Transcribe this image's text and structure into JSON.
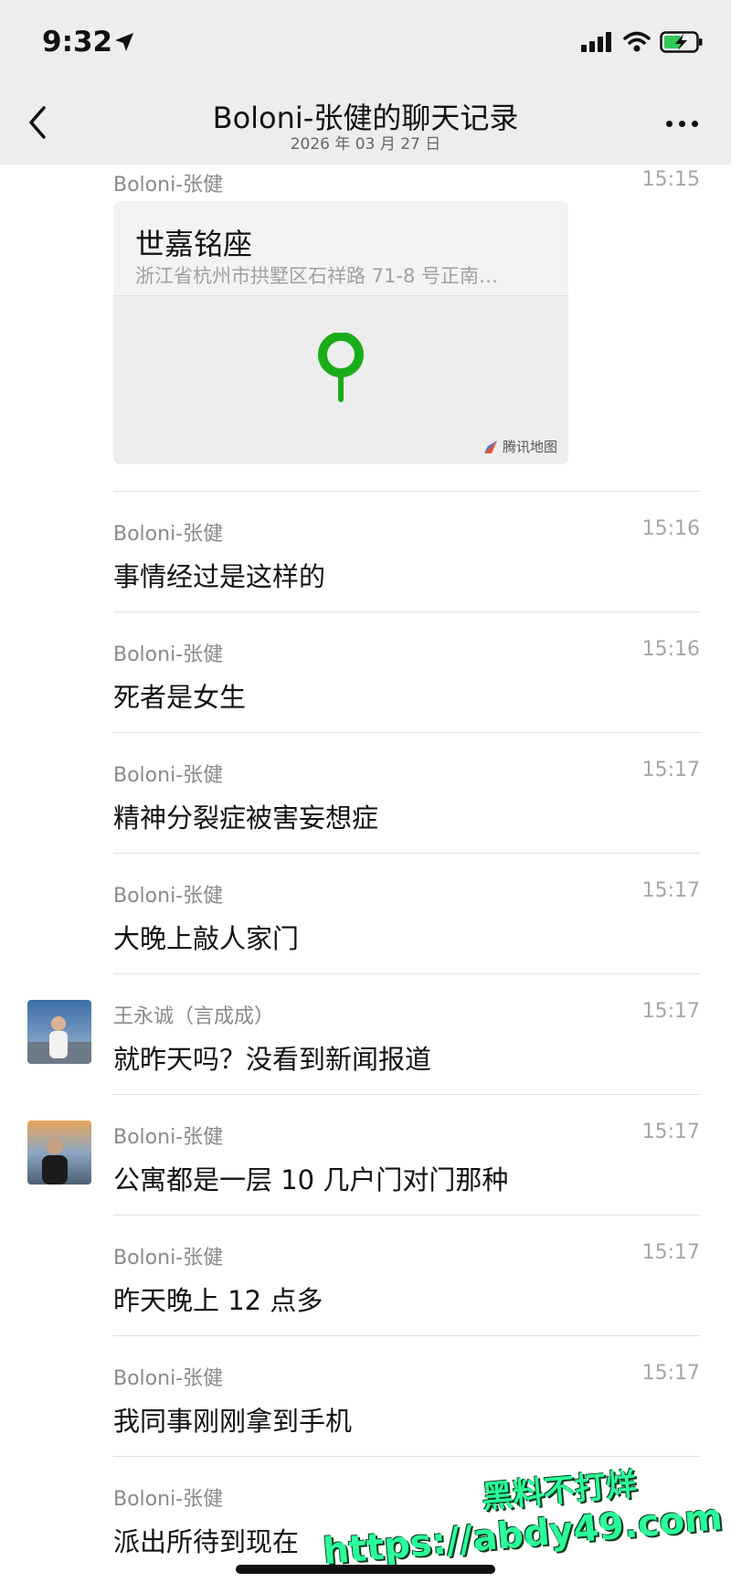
{
  "status_bar": {
    "time": "9:32"
  },
  "nav": {
    "title": "Boloni-张健的聊天记录",
    "subtitle": "2026 年 03 月 27 日"
  },
  "location": {
    "sender": "Boloni-张健",
    "time": "15:15",
    "name": "世嘉铭座",
    "address": "浙江省杭州市拱墅区石祥路 71-8 号正南…",
    "map_brand": "腾讯地图",
    "pin_color": "#1aad19"
  },
  "messages": [
    {
      "sender": "Boloni-张健",
      "time": "15:16",
      "text": "事情经过是这样的"
    },
    {
      "sender": "Boloni-张健",
      "time": "15:16",
      "text": "死者是女生"
    },
    {
      "sender": "Boloni-张健",
      "time": "15:17",
      "text": "精神分裂症被害妄想症"
    },
    {
      "sender": "Boloni-张健",
      "time": "15:17",
      "text": "大晚上敲人家门"
    },
    {
      "sender": "王永诚（言成成）",
      "time": "15:17",
      "text": "就昨天吗？没看到新闻报道"
    },
    {
      "sender": "Boloni-张健",
      "time": "15:17",
      "text": "公寓都是一层 10 几户门对门那种"
    },
    {
      "sender": "Boloni-张健",
      "time": "15:17",
      "text": "昨天晚上 12 点多"
    },
    {
      "sender": "Boloni-张健",
      "time": "15:17",
      "text": "我同事刚刚拿到手机"
    },
    {
      "sender": "Boloni-张健",
      "time": "",
      "text": "派出所待到现在"
    }
  ],
  "watermark": {
    "line1": "黑料不打烊",
    "line2": "https://abdy49.com"
  }
}
